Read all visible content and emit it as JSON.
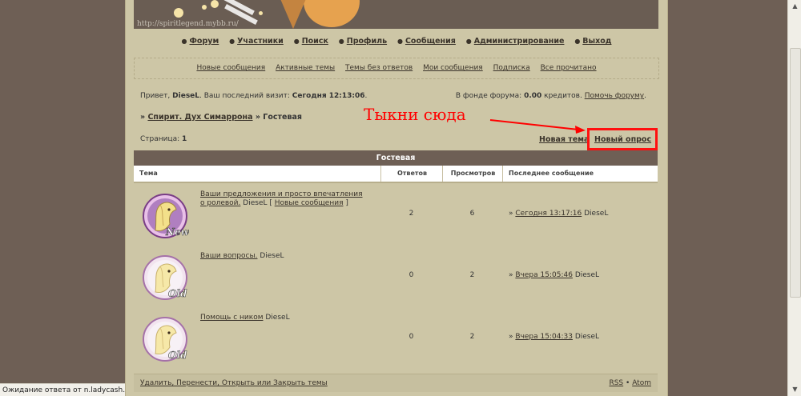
{
  "banner": {
    "url": "http://spiritlegend.mybb.ru/"
  },
  "mainnav": [
    "Форум",
    "Участники",
    "Поиск",
    "Профиль",
    "Сообщения",
    "Администрирование",
    "Выход"
  ],
  "subnav": [
    "Новые сообщения",
    "Активные темы",
    "Темы без ответов",
    "Мои сообщения",
    "Подписка",
    "Все прочитано"
  ],
  "welcome": {
    "greeting": "Привет,",
    "user": "DieseL",
    "last_visit_label": ". Ваш последний визит:",
    "last_visit": "Сегодня 12:13:06",
    "fund_label": "В фонде форума:",
    "fund_value": "0.00",
    "fund_unit": "кредитов.",
    "help_link": "Помочь форуму"
  },
  "breadcrumb": {
    "parent": "Спирит. Дух Симаррона",
    "current": "Гостевая"
  },
  "pager": {
    "label": "Страница:",
    "page": "1"
  },
  "actions": {
    "new_topic": "Новая тема",
    "new_poll": "Новый опрос"
  },
  "annotation": {
    "text": "Тыкни сюда"
  },
  "forum": {
    "caption": "Гостевая",
    "headers": {
      "topic": "Тема",
      "replies": "Ответов",
      "views": "Просмотров",
      "last": "Последнее сообщение"
    },
    "rows": [
      {
        "title": "Ваши предложения и просто впечатления о ролевой.",
        "author": "DieseL",
        "new_link": "Новые сообщения",
        "replies": "2",
        "views": "6",
        "last_time": "Сегодня 13:17:16",
        "last_author": "DieseL",
        "badge": "New"
      },
      {
        "title": "Ваши вопросы.",
        "author": "DieseL",
        "replies": "0",
        "views": "2",
        "last_time": "Вчера 15:05:46",
        "last_author": "DieseL",
        "badge": "Old"
      },
      {
        "title": "Помощь с ником",
        "author": "DieseL",
        "replies": "0",
        "views": "2",
        "last_time": "Вчера 15:04:33",
        "last_author": "DieseL",
        "badge": "Old"
      }
    ]
  },
  "footer": {
    "mod_actions": "Удалить, Перенести, Открыть или Закрыть темы",
    "rss": "RSS",
    "sep": "•",
    "atom": "Atom"
  },
  "statusbar": {
    "text": "Ожидание ответа от n.ladycash.ru..."
  },
  "colors": {
    "page_bg": "#cdc6a6",
    "outer_bg": "#6e5f55",
    "annotation": "#ff0000"
  }
}
